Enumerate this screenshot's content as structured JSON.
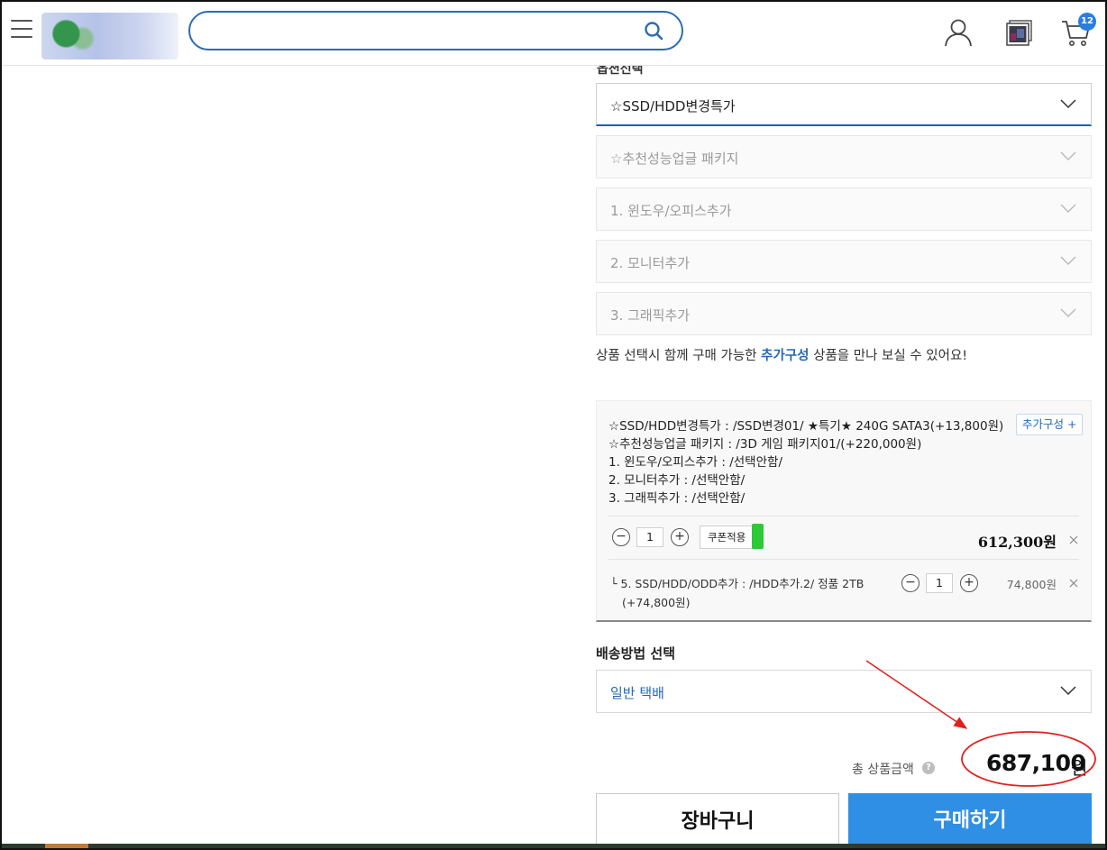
{
  "header": {
    "search_placeholder": "",
    "cart_count": "12"
  },
  "options": {
    "title": "옵션선택",
    "selects": [
      {
        "label": "☆SSD/HDD변경특가"
      },
      {
        "label": "☆추천성능업글 패키지"
      },
      {
        "label": "1. 윈도우/오피스추가"
      },
      {
        "label": "2. 모니터추가"
      },
      {
        "label": "3. 그래픽추가"
      }
    ],
    "notice_before": "상품 선택시 함께 구매 가능한 ",
    "notice_highlight": "추가구성",
    "notice_after": " 상품을 만나 보실 수 있어요!"
  },
  "selected": {
    "lines": [
      "☆SSD/HDD변경특가 : /SSD변경01/ ★특기★ 240G SATA3(+13,800원)",
      "☆추천성능업글 패키지 : /3D 게임 패키지01/(+220,000원)",
      "1. 윈도우/오피스추가 : /선택안함/",
      "2. 모니터추가 : /선택안함/",
      "3. 그래픽추가 : /선택안함/"
    ],
    "add_config_label": "추가구성 +",
    "qty": "1",
    "coupon_label": "쿠폰적용",
    "price": "612,300원",
    "sub_item": {
      "line1": "└ 5. SSD/HDD/ODD추가 : /HDD추가.2/ 정품 2TB",
      "line2": "(+74,800원)",
      "qty": "1",
      "price": "74,800원"
    }
  },
  "shipping": {
    "title": "배송방법 선택",
    "value": "일반 택배"
  },
  "total": {
    "label": "총 상품금액",
    "amount": "687,100",
    "unit": "원"
  },
  "buttons": {
    "cart": "장바구니",
    "buy": "구매하기"
  },
  "colors": {
    "accent": "#2f8fe5",
    "link": "#2468b8",
    "annotation": "#e02020"
  }
}
